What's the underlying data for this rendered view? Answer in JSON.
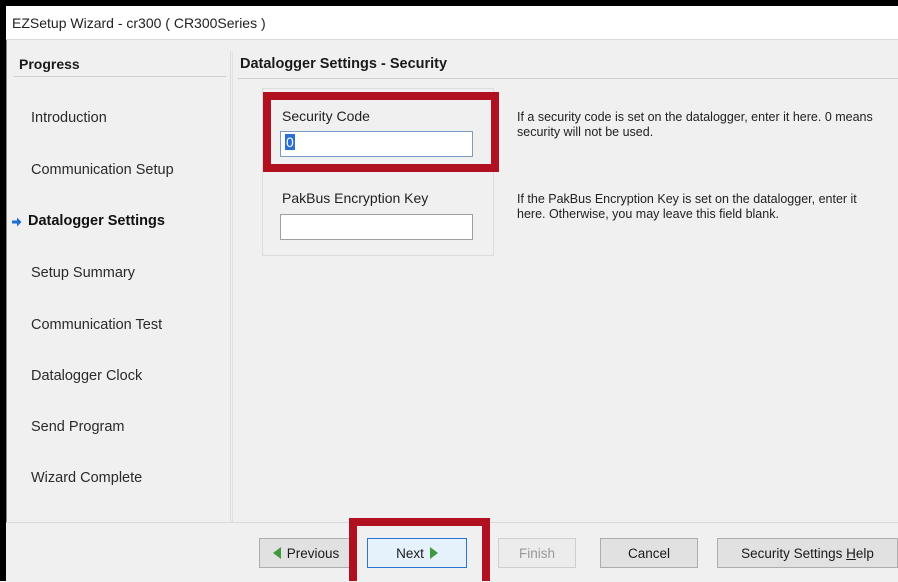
{
  "window": {
    "title": "EZSetup Wizard - cr300 ( CR300Series )"
  },
  "sidebar": {
    "header": "Progress",
    "steps": [
      {
        "label": "Introduction",
        "active": false
      },
      {
        "label": "Communication Setup",
        "active": false
      },
      {
        "label": "Datalogger Settings",
        "active": true
      },
      {
        "label": "Setup Summary",
        "active": false
      },
      {
        "label": "Communication Test",
        "active": false
      },
      {
        "label": "Datalogger Clock",
        "active": false
      },
      {
        "label": "Send Program",
        "active": false
      },
      {
        "label": "Wizard Complete",
        "active": false
      }
    ]
  },
  "main": {
    "section_title": "Datalogger Settings - Security",
    "security_code": {
      "label": "Security Code",
      "value": "0",
      "help": "If a security code is set on the datalogger, enter it here.  0 means security will not be used."
    },
    "pakbus_key": {
      "label": "PakBus Encryption Key",
      "value": "",
      "help": "If the PakBus Encryption Key is set on the datalogger, enter it here.  Otherwise, you may leave this field blank."
    }
  },
  "buttons": {
    "previous": "Previous",
    "next": "Next",
    "finish": "Finish",
    "cancel": "Cancel",
    "help_prefix": "Security Settings ",
    "help_accel": "H",
    "help_suffix": "elp"
  },
  "colors": {
    "highlight_box": "#b01020",
    "nav_arrow": "#3f9a3f",
    "active_step_arrow": "#1e6fd0"
  }
}
